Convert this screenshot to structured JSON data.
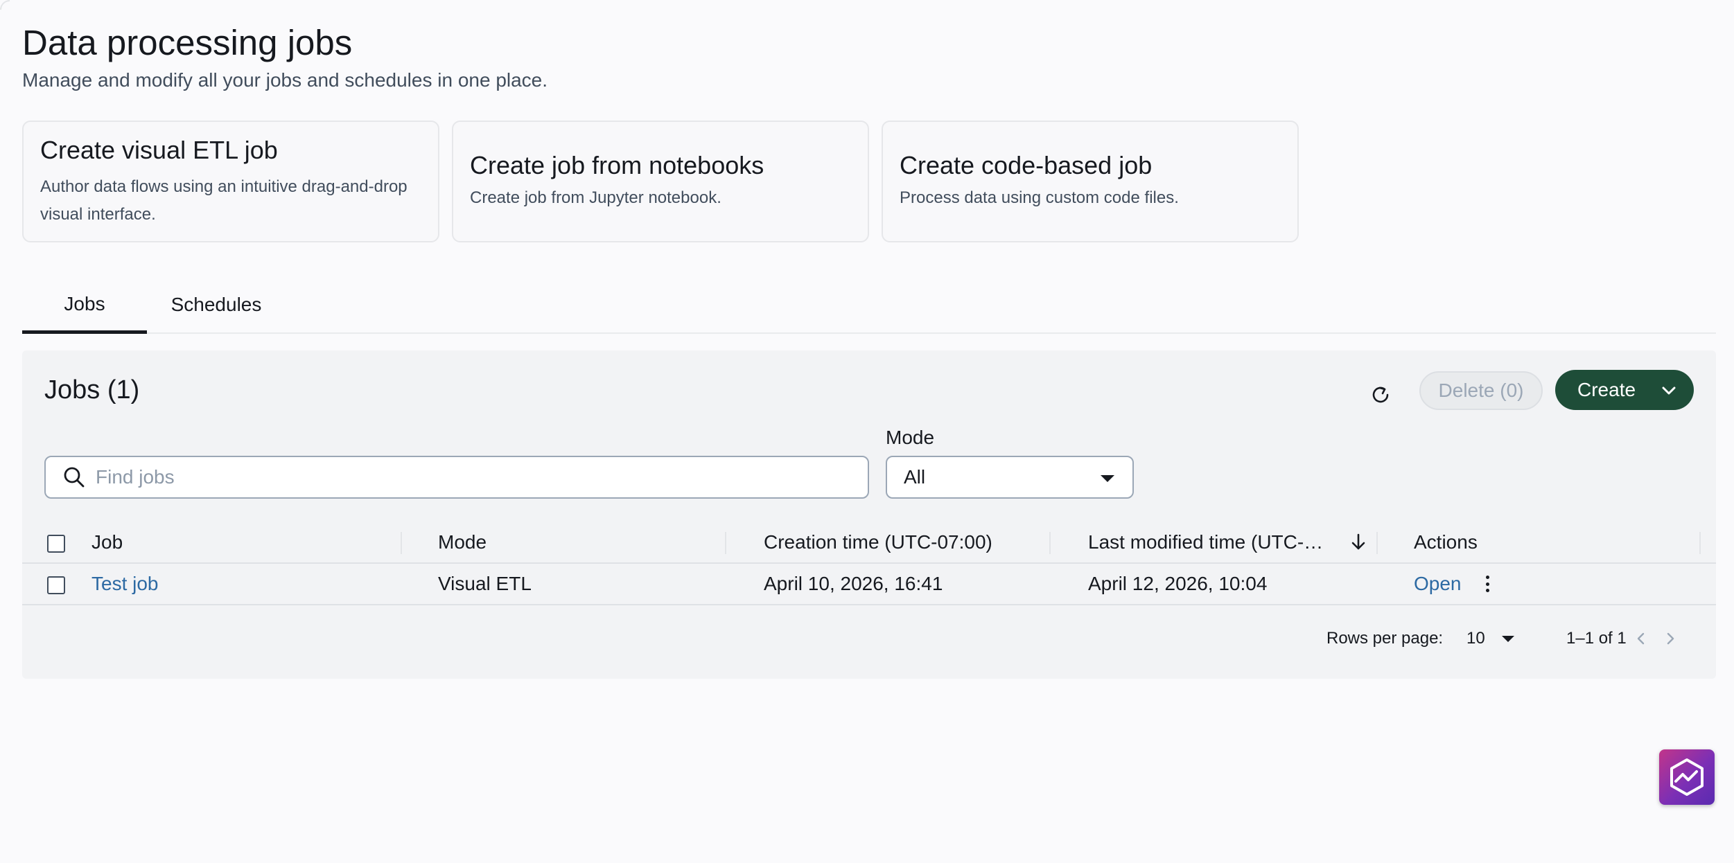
{
  "header": {
    "title": "Data processing jobs",
    "subtitle": "Manage and modify all your jobs and schedules in one place."
  },
  "cards": [
    {
      "title": "Create visual ETL job",
      "description": "Author data flows using an intuitive drag-and-drop visual interface."
    },
    {
      "title": "Create job from notebooks",
      "description": "Create job from Jupyter notebook."
    },
    {
      "title": "Create code-based job",
      "description": "Process data using custom code files."
    }
  ],
  "tabs": [
    {
      "label": "Jobs",
      "active": true
    },
    {
      "label": "Schedules",
      "active": false
    }
  ],
  "jobs_panel": {
    "title": "Jobs (1)",
    "refresh_icon": "refresh-icon",
    "delete_label": "Delete (0)",
    "create_label": "Create",
    "search": {
      "placeholder": "Find jobs",
      "value": ""
    },
    "mode_filter": {
      "label": "Mode",
      "value": "All"
    },
    "columns": [
      "Job",
      "Mode",
      "Creation time (UTC-07:00)",
      "Last modified time (UTC-…",
      "Actions"
    ],
    "sort": {
      "column": "Last modified time (UTC-…",
      "direction": "descending"
    },
    "rows": [
      {
        "job": "Test job",
        "mode": "Visual ETL",
        "created": "April 10, 2026, 16:41",
        "modified": "April 12, 2026, 10:04",
        "action": "Open"
      }
    ],
    "pagination": {
      "rows_per_page_label": "Rows per page:",
      "rows_per_page": "10",
      "range": "1–1 of 1"
    }
  },
  "colors": {
    "primary_button": "#1e4d38",
    "link": "#2d6aa3",
    "background": "#fafafc"
  }
}
